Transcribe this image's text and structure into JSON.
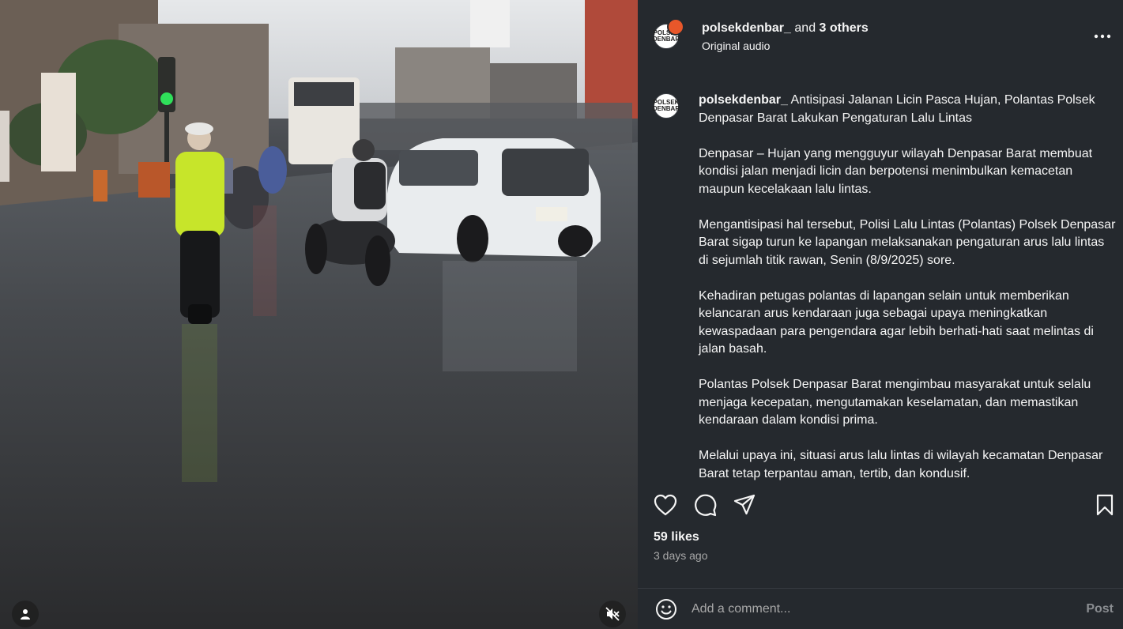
{
  "post": {
    "header": {
      "username": "polsekdenbar_",
      "and_text": "and",
      "others": "3 others",
      "audio": "Original audio",
      "avatar_text": "POLSEK DENBAR"
    },
    "caption": {
      "username": "polsekdenbar_",
      "title": "Antisipasi Jalanan Licin Pasca Hujan, Polantas Polsek Denpasar Barat Lakukan Pengaturan Lalu Lintas",
      "paragraphs": [
        "Denpasar – Hujan yang mengguyur wilayah Denpasar Barat membuat kondisi jalan menjadi licin dan berpotensi menimbulkan kemacetan maupun kecelakaan lalu lintas.",
        "Mengantisipasi hal tersebut, Polisi Lalu Lintas (Polantas) Polsek Denpasar Barat sigap turun ke lapangan melaksanakan pengaturan arus lalu lintas di sejumlah titik rawan, Senin (8/9/2025) sore.",
        "Kehadiran petugas polantas di lapangan selain untuk memberikan kelancaran arus kendaraan juga sebagai upaya meningkatkan kewaspadaan para pengendara agar lebih berhati-hati saat melintas di jalan basah.",
        "Polantas Polsek Denpasar Barat mengimbau masyarakat untuk selalu menjaga kecepatan, mengutamakan keselamatan, dan memastikan kendaraan dalam kondisi prima.",
        "Melalui upaya ini, situasi arus lalu lintas di wilayah kecamatan Denpasar Barat tetap terpantau aman, tertib, dan kondusif."
      ]
    },
    "likes": "59 likes",
    "time": "3 days ago",
    "comment": {
      "placeholder": "Add a comment...",
      "post_label": "Post"
    }
  },
  "icons": {
    "more": "more-icon",
    "like": "heart-icon",
    "comment": "comment-icon",
    "share": "share-icon",
    "save": "bookmark-icon",
    "emoji": "emoji-icon",
    "tag": "user-tag-icon",
    "mute": "muted-speaker-icon"
  },
  "colors": {
    "panel_bg": "#25292e",
    "text": "#f5f5f5",
    "muted_text": "#a8a8a8",
    "post_button": "#8a8d91"
  }
}
